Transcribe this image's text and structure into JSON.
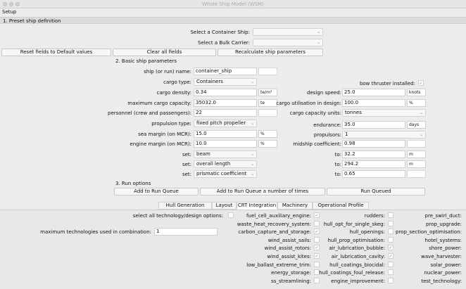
{
  "window": {
    "title": "Whole Ship Model (WSM)"
  },
  "menu": {
    "setup": "Setup"
  },
  "section1": {
    "title": "1. Preset ship definition",
    "container_label": "Select a Container Ship:",
    "bulk_label": "Select a Bulk Carrier:",
    "reset_btn": "Reset fields to Default values",
    "clear_btn": "Clear all fields",
    "recalc_btn": "Recalculate ship parameters"
  },
  "section2": {
    "title": "2. Basic ship parameters",
    "ship_name_label": "ship (or run) name:",
    "ship_name": "container_ship",
    "cargo_type_label": "cargo type:",
    "cargo_type": "Containers",
    "bow_label": "bow thruster installed:",
    "bow_check": "✓",
    "cargo_density_label": "cargo density:",
    "cargo_density": "0.34",
    "cargo_density_unit": "te/m³",
    "design_speed_label": "design speed:",
    "design_speed": "25.0",
    "design_speed_unit": "knots",
    "max_cargo_label": "maximum cargo capacity:",
    "max_cargo": "35032.0",
    "max_cargo_unit": "te",
    "util_label": "cargo utilisation in design:",
    "util": "100.0",
    "util_unit": "%",
    "personnel_label": "personnel (crew and passengers):",
    "personnel": "22",
    "cap_units_label": "cargo capacity units:",
    "cap_units": "tonnes",
    "prop_type_label": "propulsion type:",
    "prop_type": "fixed pitch propeller",
    "endurance_label": "endurance:",
    "endurance": "35.0",
    "endurance_unit": "days",
    "sea_margin_label": "sea margin (on MCR):",
    "sea_margin": "15.0",
    "sea_margin_unit": "%",
    "propulsors_label": "propulsors:",
    "propulsors": "1",
    "engine_margin_label": "engine margin (on MCR):",
    "engine_margin": "10.0",
    "engine_margin_unit": "%",
    "midship_label": "midship coefficient:",
    "midship": "0.98",
    "set_label": "set:",
    "set1": "beam",
    "set2": "overall length",
    "set3": "prismatic coefficient",
    "to_label": "to:",
    "to1": "32.2",
    "to1_unit": "m",
    "to2": "294.2",
    "to2_unit": "m",
    "to3": "0.65"
  },
  "section3": {
    "title": "3. Run options",
    "add_btn": "Add to Run Queue",
    "add_n_btn": "Add to Run Queue a number of times",
    "run_btn": "Run Queued"
  },
  "tabs": [
    "Hull Generation",
    "Layout",
    "CRT Integration",
    "Machinery",
    "Operational Profile"
  ],
  "crt": {
    "select_all_label": "select all technology/design options:",
    "max_tech_label": "maximum technologies used in combination:",
    "max_tech": "1",
    "col1": [
      {
        "label": "fuel_cell_auxiliary_engine:",
        "mark": "✓"
      },
      {
        "label": "waste_heat_recovery_system:",
        "mark": ""
      },
      {
        "label": "carbon_capture_and_storage:",
        "mark": "✓"
      },
      {
        "label": "wind_assist_sails:",
        "mark": ""
      },
      {
        "label": "wind_assist_rotors:",
        "mark": "✓"
      },
      {
        "label": "wind_assist_kites:",
        "mark": "✓"
      },
      {
        "label": "low_ballast_extreme_trim:",
        "mark": ""
      },
      {
        "label": "energy_storage:",
        "mark": ""
      },
      {
        "label": "ss_streamlining:",
        "mark": ""
      }
    ],
    "col2": [
      {
        "label": "rudders:",
        "mark": ""
      },
      {
        "label": "hull_opt_for_single_skeg:",
        "mark": ""
      },
      {
        "label": "hull_openings:",
        "mark": ""
      },
      {
        "label": "hull_prop_optimisation:",
        "mark": ""
      },
      {
        "label": "air_lubrication_bubble:",
        "mark": "✓"
      },
      {
        "label": "air_lubrication_cavity:",
        "mark": "✓"
      },
      {
        "label": "hull_coatings_biocidal:",
        "mark": ""
      },
      {
        "label": "hull_coatings_foul_release:",
        "mark": ""
      },
      {
        "label": "engine_improvement:",
        "mark": ""
      }
    ],
    "col3": [
      {
        "label": "pre_swirl_duct:"
      },
      {
        "label": "prop_upgrade:"
      },
      {
        "label": "prop_section_optimisation:"
      },
      {
        "label": "hotel_systems:"
      },
      {
        "label": "shore_power:"
      },
      {
        "label": "wave_harvester:"
      },
      {
        "label": "solar_power:"
      },
      {
        "label": "nuclear_power:"
      },
      {
        "label": "test_technology:"
      }
    ]
  }
}
